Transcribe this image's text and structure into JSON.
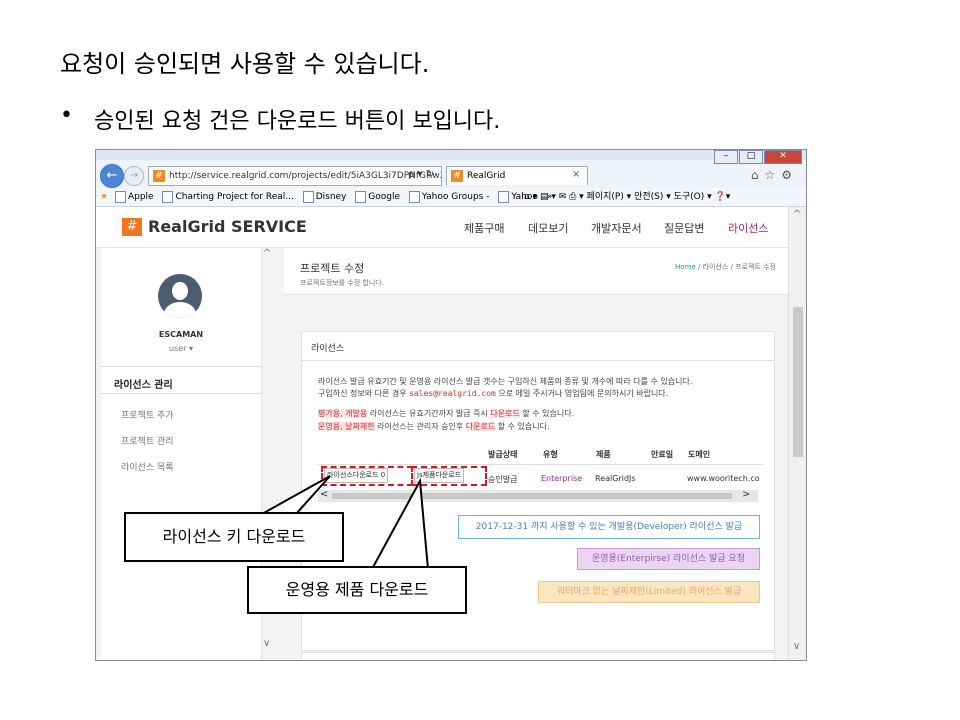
{
  "slide": {
    "title": "요청이 승인되면 사용할 수 있습니다.",
    "bullet_marker": "•",
    "bullet": "승인된 요청 건은 다운로드 버튼이 보입니다."
  },
  "browser": {
    "window_buttons": [
      "–",
      "□",
      "✕"
    ],
    "back_icon": "←",
    "forward_icon": "→",
    "url": "http://service.realgrid.com/projects/edit/5iA3GL3i7DPNfGRw2",
    "addr_controls": "ρ ▾ ↻",
    "tab_title": "RealGrid",
    "tab_close": "×",
    "right_icons": "⌂☆⚙",
    "favorites": [
      "Apple",
      "Charting Project for Real...",
      "Disney",
      "Google",
      "Yahoo Groups -",
      "Yahoo"
    ],
    "fav_more": "»",
    "toolbar_right": "⌂ ▾  ▤ ▾  ✉  ⎙ ▾  페이지(P) ▾  안전(S) ▾  도구(O) ▾  ❓▾"
  },
  "site": {
    "logo_symbol": "#",
    "logo_text": "RealGrid SERVICE",
    "menu": [
      "제품구매",
      "데모보기",
      "개발자문서",
      "질문답변",
      "라이선스"
    ],
    "user": {
      "name": "ESCAMAN",
      "role": "user ▾"
    },
    "sidebar_heading": "라이선스 관리",
    "sidebar_items": [
      "프로젝트 추가",
      "프로젝트 관리",
      "라이선스 목록"
    ],
    "scroll_up": "^",
    "scroll_down": "∨",
    "page_title": "프로젝트 수정",
    "page_sub": "프로젝트정보를 수정 합니다.",
    "breadcrumb": {
      "home": "Home",
      "sep": "/",
      "mid": "라이선스",
      "last": "프로젝트 수정"
    },
    "panel_title": "라이선스",
    "text": {
      "line1": "라이선스 발급 유효기간 및 운영용 라이선스 발급 갯수는 구입하신 제품의 종류 및 개수에 따라 다를 수 있습니다.",
      "line2a": "구입하신 정보와 다른 경우",
      "email": "sales@realgrid.com",
      "line2b": "으로 메일 주시거나 영업팀에 문의하시기 바랍니다.",
      "line3a": "평가용, 개발용",
      "line3b": "라이선스는 유효기간까지 발급 즉시",
      "line3c": "다운로드",
      "line3d": "할 수 있습니다.",
      "line4a": "운영용, 날짜제한",
      "line4b": "라이선스는 관리자 승인후",
      "line4c": "다운로드",
      "line4d": "할 수 있습니다."
    },
    "table": {
      "headers": [
        "발급상태",
        "유형",
        "제품",
        "만료일",
        "도메인"
      ],
      "row": {
        "btn_license": "라이선스다운로드 0",
        "btn_product": "js제품다운로드",
        "status": "승인발급",
        "type": "Enterprise",
        "product": "RealGridJs",
        "expire": "",
        "domain": "www.wooritech.co"
      }
    },
    "hscroll": {
      "left": "<",
      "right": ">"
    },
    "buttons": {
      "dev": "2017-12-31 까지 사용할 수 있는 개발용(Developer) 라이선스 발급",
      "ent": "운영용(Enterpirse) 라이선스 발급 요청",
      "limited": "워터마크 없는 날짜제한(Limited) 라이선스 발급"
    },
    "vscroll_up": "^",
    "vscroll_down": "∨"
  },
  "callouts": {
    "license": "라이선스 키 다운로드",
    "product": "운영용 제품 다운로드"
  },
  "colors": {
    "brand": "#f37321",
    "active_menu": "#a5216f",
    "highlight_red": "#e0141d"
  }
}
